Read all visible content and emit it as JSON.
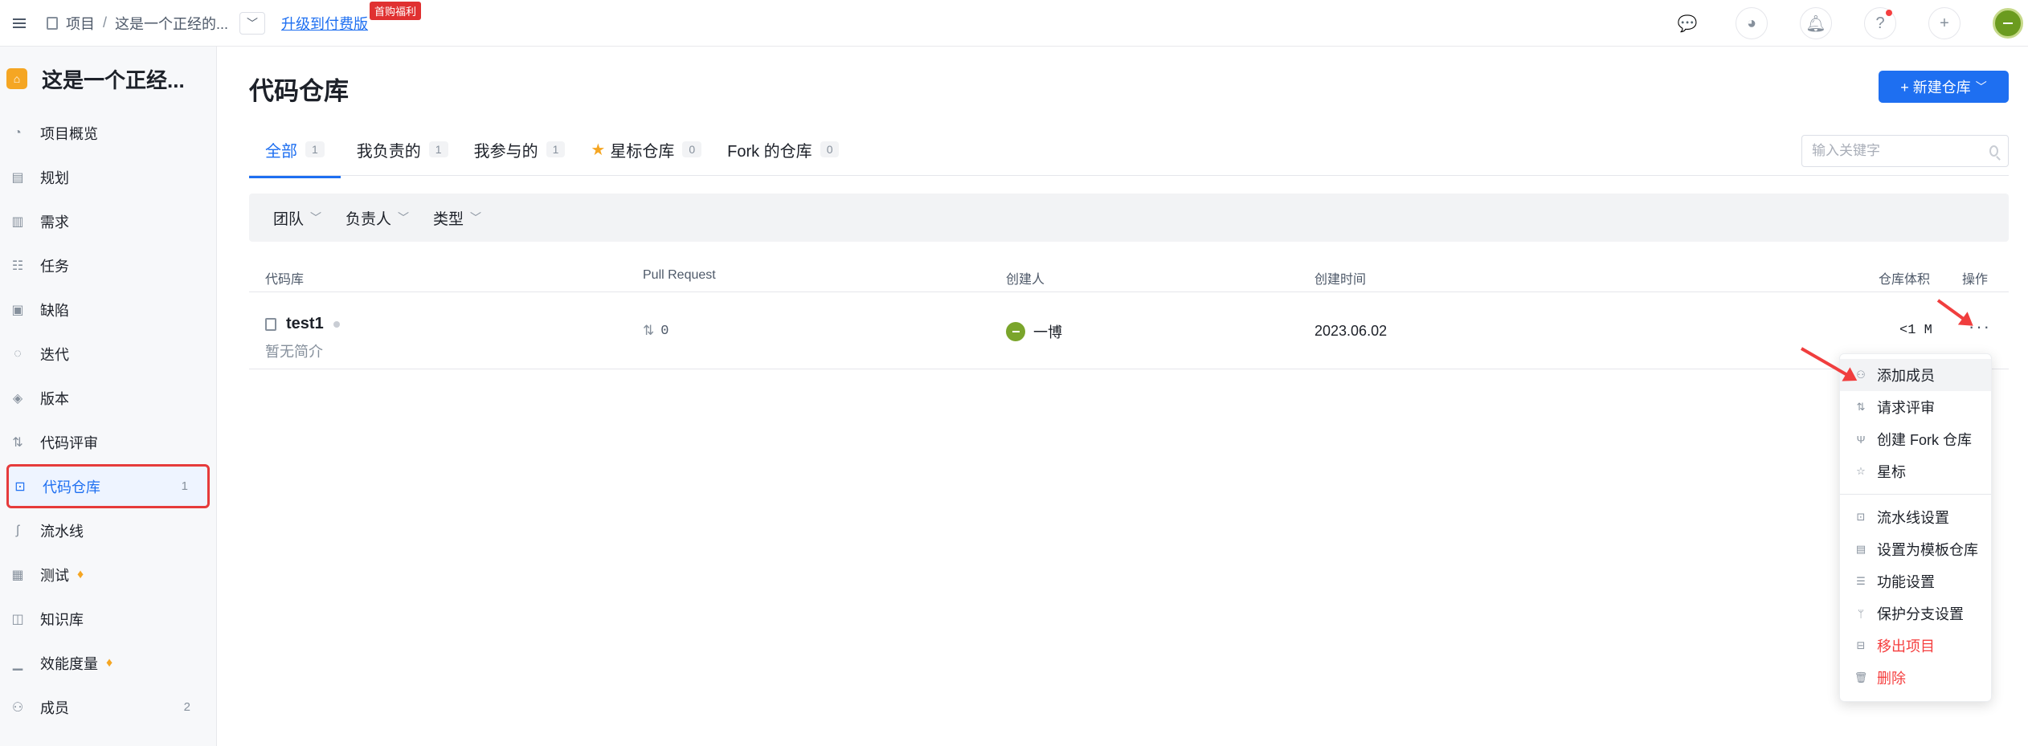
{
  "topbar": {
    "breadcrumb_root": "项目",
    "breadcrumb_sep": "/",
    "breadcrumb_project": "这是一个正经的...",
    "upgrade_link": "升级到付费版",
    "promo_badge": "首购福利"
  },
  "sidebar": {
    "project_name": "这是一个正经...",
    "items": [
      {
        "label": "项目概览",
        "icon": "dashboard-icon",
        "count": ""
      },
      {
        "label": "规划",
        "icon": "plan-icon",
        "count": ""
      },
      {
        "label": "需求",
        "icon": "requirement-icon",
        "count": ""
      },
      {
        "label": "任务",
        "icon": "task-icon",
        "count": ""
      },
      {
        "label": "缺陷",
        "icon": "bug-icon",
        "count": ""
      },
      {
        "label": "迭代",
        "icon": "iteration-icon",
        "count": ""
      },
      {
        "label": "版本",
        "icon": "layers-icon",
        "count": ""
      },
      {
        "label": "代码评审",
        "icon": "code-review-icon",
        "count": ""
      },
      {
        "label": "代码仓库",
        "icon": "code-repo-icon",
        "count": "1"
      },
      {
        "label": "流水线",
        "icon": "pipeline-icon",
        "count": ""
      },
      {
        "label": "测试",
        "icon": "test-icon",
        "count": ""
      },
      {
        "label": "知识库",
        "icon": "book-icon",
        "count": ""
      },
      {
        "label": "效能度量",
        "icon": "chart-icon",
        "count": ""
      },
      {
        "label": "成员",
        "icon": "members-icon",
        "count": "2"
      }
    ]
  },
  "main": {
    "title": "代码仓库",
    "new_button": "+ 新建仓库",
    "tabs": [
      {
        "label": "全部",
        "count": "1"
      },
      {
        "label": "我负责的",
        "count": "1"
      },
      {
        "label": "我参与的",
        "count": "1"
      },
      {
        "label": "星标仓库",
        "count": "0"
      },
      {
        "label": "Fork 的仓库",
        "count": "0"
      }
    ],
    "search_placeholder": "输入关键字",
    "filters": [
      "团队",
      "负责人",
      "类型"
    ],
    "columns": {
      "repo": "代码库",
      "pr": "Pull Request",
      "creator": "创建人",
      "created": "创建时间",
      "size": "仓库体积",
      "actions": "操作"
    },
    "row": {
      "name": "test1",
      "desc": "暂无简介",
      "pr_count": "0",
      "creator": "一博",
      "created": "2023.06.02",
      "size": "<1 M",
      "more": "···"
    }
  },
  "menu": {
    "items": [
      {
        "label": "添加成员",
        "icon": "user-icon"
      },
      {
        "label": "请求评审",
        "icon": "review-icon"
      },
      {
        "label": "创建 Fork 仓库",
        "icon": "fork-icon"
      },
      {
        "label": "星标",
        "icon": "star-icon"
      }
    ],
    "items2": [
      {
        "label": "流水线设置",
        "icon": "pipeline-icon"
      },
      {
        "label": "设置为模板仓库",
        "icon": "template-icon"
      },
      {
        "label": "功能设置",
        "icon": "settings-icon"
      },
      {
        "label": "保护分支设置",
        "icon": "branch-icon"
      },
      {
        "label": "移出项目",
        "icon": "remove-icon"
      },
      {
        "label": "删除",
        "icon": "trash-icon"
      }
    ]
  },
  "colors": {
    "accent": "#1e6ff1",
    "danger": "#f53f3f",
    "highlight_box": "#e63b3b"
  }
}
